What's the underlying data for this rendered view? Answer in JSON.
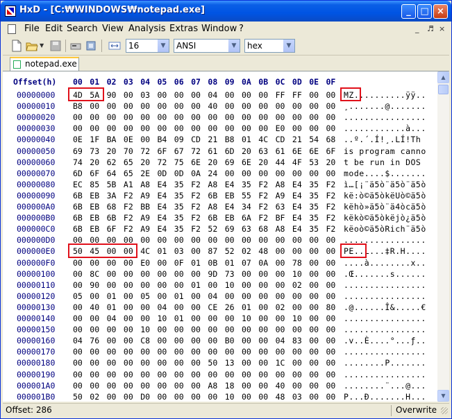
{
  "window": {
    "title": "HxD - [C:₩WINDOWS₩notepad.exe]",
    "buttons": {
      "minimize": "_",
      "maximize": "□",
      "close": "×"
    }
  },
  "menu": {
    "items": [
      "File",
      "Edit",
      "Search",
      "View",
      "Analysis",
      "Extras",
      "Window",
      "?"
    ],
    "mdi_controls": [
      "_",
      "♬",
      "×"
    ]
  },
  "toolbar": {
    "bytes_per_row": "16",
    "charset": "ANSI",
    "offset_base": "hex"
  },
  "tabs": [
    {
      "label": "notepad.exe"
    }
  ],
  "hexview": {
    "header_label": "Offset(h)",
    "columns": [
      "00",
      "01",
      "02",
      "03",
      "04",
      "05",
      "06",
      "07",
      "08",
      "09",
      "0A",
      "0B",
      "0C",
      "0D",
      "0E",
      "0F"
    ],
    "rows": [
      {
        "offset": "00000000",
        "bytes": [
          "4D",
          "5A",
          "90",
          "00",
          "03",
          "00",
          "00",
          "00",
          "04",
          "00",
          "00",
          "00",
          "FF",
          "FF",
          "00",
          "00"
        ],
        "text": "MZ..........ÿÿ.."
      },
      {
        "offset": "00000010",
        "bytes": [
          "B8",
          "00",
          "00",
          "00",
          "00",
          "00",
          "00",
          "00",
          "40",
          "00",
          "00",
          "00",
          "00",
          "00",
          "00",
          "00"
        ],
        "text": "¸.......@......."
      },
      {
        "offset": "00000020",
        "bytes": [
          "00",
          "00",
          "00",
          "00",
          "00",
          "00",
          "00",
          "00",
          "00",
          "00",
          "00",
          "00",
          "00",
          "00",
          "00",
          "00"
        ],
        "text": "................"
      },
      {
        "offset": "00000030",
        "bytes": [
          "00",
          "00",
          "00",
          "00",
          "00",
          "00",
          "00",
          "00",
          "00",
          "00",
          "00",
          "00",
          "E0",
          "00",
          "00",
          "00"
        ],
        "text": "............à..."
      },
      {
        "offset": "00000040",
        "bytes": [
          "0E",
          "1F",
          "BA",
          "0E",
          "00",
          "B4",
          "09",
          "CD",
          "21",
          "B8",
          "01",
          "4C",
          "CD",
          "21",
          "54",
          "68"
        ],
        "text": "..º.´.Í!¸.LÍ!Th"
      },
      {
        "offset": "00000050",
        "bytes": [
          "69",
          "73",
          "20",
          "70",
          "72",
          "6F",
          "67",
          "72",
          "61",
          "6D",
          "20",
          "63",
          "61",
          "6E",
          "6E",
          "6F"
        ],
        "text": "is program canno"
      },
      {
        "offset": "00000060",
        "bytes": [
          "74",
          "20",
          "62",
          "65",
          "20",
          "72",
          "75",
          "6E",
          "20",
          "69",
          "6E",
          "20",
          "44",
          "4F",
          "53",
          "20"
        ],
        "text": "t be run in DOS "
      },
      {
        "offset": "00000070",
        "bytes": [
          "6D",
          "6F",
          "64",
          "65",
          "2E",
          "0D",
          "0D",
          "0A",
          "24",
          "00",
          "00",
          "00",
          "00",
          "00",
          "00",
          "00"
        ],
        "text": "mode....$......."
      },
      {
        "offset": "00000080",
        "bytes": [
          "EC",
          "85",
          "5B",
          "A1",
          "A8",
          "E4",
          "35",
          "F2",
          "A8",
          "E4",
          "35",
          "F2",
          "A8",
          "E4",
          "35",
          "F2"
        ],
        "text": "ì…[¡¨ä5ò¨ä5ò¨ä5ò"
      },
      {
        "offset": "00000090",
        "bytes": [
          "6B",
          "EB",
          "3A",
          "F2",
          "A9",
          "E4",
          "35",
          "F2",
          "6B",
          "EB",
          "55",
          "F2",
          "A9",
          "E4",
          "35",
          "F2"
        ],
        "text": "kë:ò©ä5òkëUò©ä5ò"
      },
      {
        "offset": "000000A0",
        "bytes": [
          "6B",
          "EB",
          "68",
          "F2",
          "BB",
          "E4",
          "35",
          "F2",
          "A8",
          "E4",
          "34",
          "F2",
          "63",
          "E4",
          "35",
          "F2"
        ],
        "text": "këhò»ä5ò¨ä4òcä5ò"
      },
      {
        "offset": "000000B0",
        "bytes": [
          "6B",
          "EB",
          "6B",
          "F2",
          "A9",
          "E4",
          "35",
          "F2",
          "6B",
          "EB",
          "6A",
          "F2",
          "BF",
          "E4",
          "35",
          "F2"
        ],
        "text": "këkò©ä5òkëjò¿ä5ò"
      },
      {
        "offset": "000000C0",
        "bytes": [
          "6B",
          "EB",
          "6F",
          "F2",
          "A9",
          "E4",
          "35",
          "F2",
          "52",
          "69",
          "63",
          "68",
          "A8",
          "E4",
          "35",
          "F2"
        ],
        "text": "këoò©ä5òRich¨ä5ò"
      },
      {
        "offset": "000000D0",
        "bytes": [
          "00",
          "00",
          "00",
          "00",
          "00",
          "00",
          "00",
          "00",
          "00",
          "00",
          "00",
          "00",
          "00",
          "00",
          "00",
          "00"
        ],
        "text": "................"
      },
      {
        "offset": "000000E0",
        "bytes": [
          "50",
          "45",
          "00",
          "00",
          "4C",
          "01",
          "03",
          "00",
          "87",
          "52",
          "02",
          "48",
          "00",
          "00",
          "00",
          "00"
        ],
        "text": "PE..L...‡R.H...."
      },
      {
        "offset": "000000F0",
        "bytes": [
          "00",
          "00",
          "00",
          "00",
          "E0",
          "00",
          "0F",
          "01",
          "0B",
          "01",
          "07",
          "0A",
          "00",
          "78",
          "00",
          "00"
        ],
        "text": "....à........x.."
      },
      {
        "offset": "00000100",
        "bytes": [
          "00",
          "8C",
          "00",
          "00",
          "00",
          "00",
          "00",
          "00",
          "9D",
          "73",
          "00",
          "00",
          "00",
          "10",
          "00",
          "00"
        ],
        "text": ".Œ.......s......"
      },
      {
        "offset": "00000110",
        "bytes": [
          "00",
          "90",
          "00",
          "00",
          "00",
          "00",
          "00",
          "01",
          "00",
          "10",
          "00",
          "00",
          "00",
          "02",
          "00",
          "00"
        ],
        "text": "................"
      },
      {
        "offset": "00000120",
        "bytes": [
          "05",
          "00",
          "01",
          "00",
          "05",
          "00",
          "01",
          "00",
          "04",
          "00",
          "00",
          "00",
          "00",
          "00",
          "00",
          "00"
        ],
        "text": "................"
      },
      {
        "offset": "00000130",
        "bytes": [
          "00",
          "40",
          "01",
          "00",
          "00",
          "04",
          "00",
          "00",
          "CE",
          "26",
          "01",
          "00",
          "02",
          "00",
          "00",
          "80"
        ],
        "text": ".@......Î&.....€"
      },
      {
        "offset": "00000140",
        "bytes": [
          "00",
          "00",
          "04",
          "00",
          "00",
          "10",
          "01",
          "00",
          "00",
          "00",
          "10",
          "00",
          "00",
          "10",
          "00",
          "00"
        ],
        "text": "................"
      },
      {
        "offset": "00000150",
        "bytes": [
          "00",
          "00",
          "00",
          "00",
          "10",
          "00",
          "00",
          "00",
          "00",
          "00",
          "00",
          "00",
          "00",
          "00",
          "00",
          "00"
        ],
        "text": "................"
      },
      {
        "offset": "00000160",
        "bytes": [
          "04",
          "76",
          "00",
          "00",
          "C8",
          "00",
          "00",
          "00",
          "00",
          "B0",
          "00",
          "00",
          "04",
          "83",
          "00",
          "00"
        ],
        "text": ".v..È....°...ƒ.."
      },
      {
        "offset": "00000170",
        "bytes": [
          "00",
          "00",
          "00",
          "00",
          "00",
          "00",
          "00",
          "00",
          "00",
          "00",
          "00",
          "00",
          "00",
          "00",
          "00",
          "00"
        ],
        "text": "................"
      },
      {
        "offset": "00000180",
        "bytes": [
          "00",
          "00",
          "00",
          "00",
          "00",
          "00",
          "00",
          "00",
          "50",
          "13",
          "00",
          "00",
          "1C",
          "00",
          "00",
          "00"
        ],
        "text": "........P......."
      },
      {
        "offset": "00000190",
        "bytes": [
          "00",
          "00",
          "00",
          "00",
          "00",
          "00",
          "00",
          "00",
          "00",
          "00",
          "00",
          "00",
          "00",
          "00",
          "00",
          "00"
        ],
        "text": "................"
      },
      {
        "offset": "000001A0",
        "bytes": [
          "00",
          "00",
          "00",
          "00",
          "00",
          "00",
          "00",
          "00",
          "A8",
          "18",
          "00",
          "00",
          "40",
          "00",
          "00",
          "00"
        ],
        "text": "........¨...@..."
      },
      {
        "offset": "000001B0",
        "bytes": [
          "50",
          "02",
          "00",
          "00",
          "D0",
          "00",
          "00",
          "00",
          "00",
          "10",
          "00",
          "00",
          "48",
          "03",
          "00",
          "00"
        ],
        "text": "P...Ð.......H..."
      }
    ]
  },
  "status": {
    "offset_label": "Offset: 286",
    "mode": "Overwrite"
  },
  "colors": {
    "highlight": "#e0101a",
    "offset_text": "#000080",
    "titlebar": "#0054e3"
  }
}
